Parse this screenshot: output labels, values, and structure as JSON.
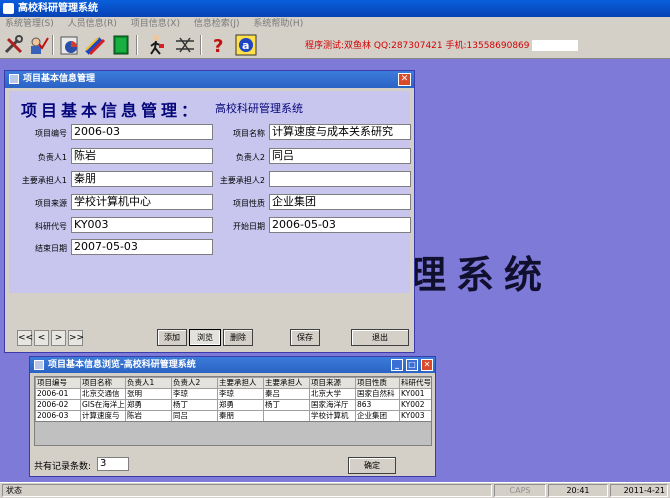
{
  "app": {
    "title": "高校科研管理系统",
    "menu": [
      "系统管理(S)",
      "人员信息(R)",
      "项目信息(X)",
      "信息检索(J)",
      "系统帮助(H)"
    ],
    "notice": "程序测试:双鱼林  QQ:287307421  手机:13558690869"
  },
  "toolbar": {
    "icons": [
      "tools-icon",
      "user-check-icon",
      "report-icon",
      "edit-pencil-icon",
      "book-icon",
      "person-walk-icon",
      "network-icon",
      "help-icon",
      "about-icon"
    ]
  },
  "watermark": "理系统",
  "form1": {
    "title": "项目基本信息管理",
    "heading": "项目基本信息管理：",
    "heading_sub": "高校科研管理系统",
    "fields": {
      "project_no": {
        "label": "项目编号",
        "value": "2006-03"
      },
      "project_name": {
        "label": "项目名称",
        "value": "计算速度与成本关系研究"
      },
      "leader1": {
        "label": "负责人1",
        "value": "陈岩"
      },
      "leader2": {
        "label": "负责人2",
        "value": "同吕"
      },
      "main1": {
        "label": "主要承担人1",
        "value": "秦朋"
      },
      "main2": {
        "label": "主要承担人2",
        "value": ""
      },
      "source": {
        "label": "项目来源",
        "value": "学校计算机中心"
      },
      "nature": {
        "label": "项目性质",
        "value": "企业集团"
      },
      "research_code": {
        "label": "科研代号",
        "value": "KY003"
      },
      "start_date": {
        "label": "开始日期",
        "value": "2006-05-03"
      },
      "end_date": {
        "label": "结束日期",
        "value": "2007-05-03"
      }
    },
    "nav": [
      "<<",
      "<",
      ">",
      ">>"
    ],
    "buttons": {
      "add": "添加",
      "browse": "浏览",
      "delete": "删除",
      "save": "保存",
      "exit": "退出"
    }
  },
  "form2": {
    "title": "项目基本信息浏览-高校科研管理系统",
    "columns": [
      "项目编号",
      "项目名称",
      "负责人1",
      "负责人2",
      "主要承担人",
      "主要承担人",
      "项目来源",
      "项目性质",
      "科研代号"
    ],
    "rows": [
      [
        "2006-01",
        "北京交通信",
        "张明",
        "李琼",
        "李琼",
        "秦吕",
        "北京大学",
        "国家自然科",
        "KY001"
      ],
      [
        "2006-02",
        "GIS在海洋上",
        "郑勇",
        "杨丁",
        "郑勇",
        "杨丁",
        "国家海洋厅",
        "863",
        "KY002"
      ],
      [
        "2006-03",
        "计算速度与",
        "陈岩",
        "同吕",
        "秦朋",
        "",
        "学校计算机",
        "企业集团",
        "KY003"
      ]
    ],
    "count_label": "共有记录条数:",
    "count_value": "3",
    "ok_label": "确定"
  },
  "status": {
    "text": "状态",
    "caps": "CAPS",
    "time": "20:41",
    "date": "2011-4-21"
  }
}
